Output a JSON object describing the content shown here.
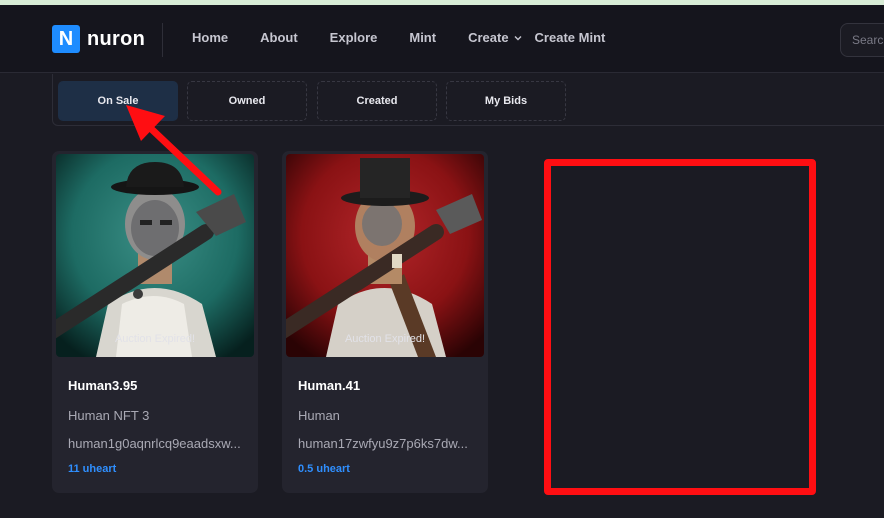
{
  "header": {
    "logo_letter": "N",
    "logo_text": "nuron",
    "nav": [
      {
        "label": "Home"
      },
      {
        "label": "About"
      },
      {
        "label": "Explore"
      },
      {
        "label": "Mint"
      },
      {
        "label": "Create"
      },
      {
        "label": "Create Mint"
      }
    ],
    "search_placeholder": "Search"
  },
  "tabs": [
    {
      "label": "On Sale",
      "active": true
    },
    {
      "label": "Owned",
      "active": false
    },
    {
      "label": "Created",
      "active": false
    },
    {
      "label": "My Bids",
      "active": false
    }
  ],
  "cards": [
    {
      "title": "Human3.95",
      "subtitle": "Human NFT 3",
      "address": "human1g0aqnrlcq9eaadsxw...",
      "price": "11 uheart",
      "status": "Auction Expired!",
      "theme": "#1d6b63"
    },
    {
      "title": "Human.41",
      "subtitle": "Human",
      "address": "human17zwfyu9z7p6ks7dw...",
      "price": "0.5 uheart",
      "status": "Auction Expired!",
      "theme": "#8a1214"
    }
  ],
  "colors": {
    "accent": "#1e8cff",
    "price": "#2f8fff",
    "annotation": "#ff0e12",
    "active_tab": "#1e2f46"
  }
}
